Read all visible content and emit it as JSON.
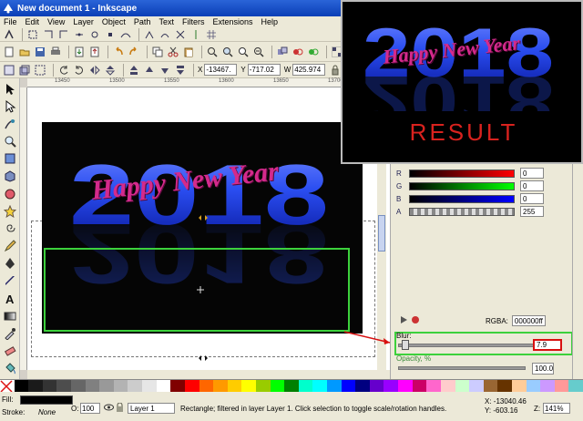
{
  "window": {
    "title": "New document 1 - Inkscape"
  },
  "menu": [
    "File",
    "Edit",
    "View",
    "Layer",
    "Object",
    "Path",
    "Text",
    "Filters",
    "Extensions",
    "Help"
  ],
  "coords": {
    "x_label": "X",
    "x_value": "-13467.",
    "y_label": "Y",
    "y_value": "-717.02",
    "w_label": "W",
    "w_value": "425.974"
  },
  "ruler": {
    "ticks": [
      "13450",
      "13500",
      "13550",
      "13600",
      "13650",
      "13700",
      "13750"
    ]
  },
  "artwork": {
    "year": "2018",
    "greeting": "Happy New Year",
    "year_color": "#2a4df0"
  },
  "result_panel": {
    "label": "RESULT"
  },
  "fill_stroke": {
    "channels": [
      {
        "label": "R",
        "value": "0"
      },
      {
        "label": "G",
        "value": "0"
      },
      {
        "label": "B",
        "value": "0"
      },
      {
        "label": "A",
        "value": "255"
      }
    ],
    "rgba_label": "RGBA:",
    "rgba_value": "000000ff",
    "blur_label": "Blur:",
    "blur_value": "7.9",
    "opacity_label": "Opacity, %",
    "opacity_value": "100.0"
  },
  "status": {
    "fill_label": "Fill:",
    "stroke_label": "Stroke:",
    "stroke_value": "None",
    "opacity_label": "O:",
    "opacity_value": "100",
    "layer": "Layer 1",
    "message": "Rectangle; filtered in layer Layer 1. Click selection to toggle scale/rotation handles.",
    "cursor_x": "X: -13040.46",
    "cursor_y": "Y:   -603.16",
    "zoom_label": "Z:",
    "zoom": "141%"
  },
  "palette_colors": [
    "#000000",
    "#1a1a1a",
    "#333333",
    "#4d4d4d",
    "#666666",
    "#808080",
    "#999999",
    "#b3b3b3",
    "#cccccc",
    "#e6e6e6",
    "#ffffff",
    "#800000",
    "#ff0000",
    "#ff6600",
    "#ff9900",
    "#ffcc00",
    "#ffff00",
    "#99cc00",
    "#00ff00",
    "#008000",
    "#00ffcc",
    "#00ffff",
    "#0099ff",
    "#0000ff",
    "#000080",
    "#6600cc",
    "#9900ff",
    "#ff00ff",
    "#cc0066",
    "#ff66cc",
    "#ffcccc",
    "#ccffcc",
    "#ccccff",
    "#996633",
    "#663300",
    "#ffcc99",
    "#99ccff",
    "#cc99ff",
    "#ff9999",
    "#66cccc"
  ]
}
